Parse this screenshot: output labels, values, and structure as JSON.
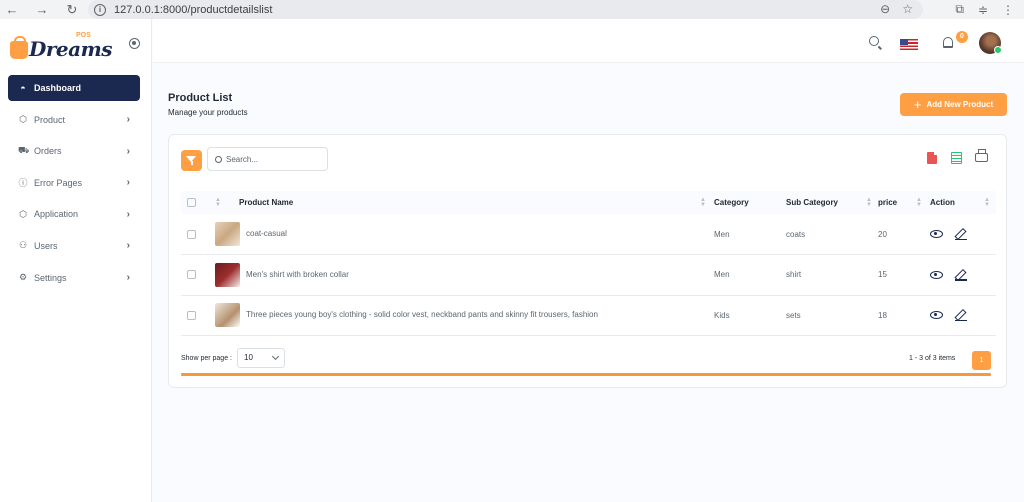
{
  "browser": {
    "url": "127.0.0.1:8000/productdetailslist",
    "back_icon": "arrow-left-icon",
    "forward_icon": "arrow-right-icon",
    "reload_icon": "reload-icon"
  },
  "brand": {
    "logo_text": "Dreams",
    "logo_sub": "POS",
    "accent_color": "#ff9f43",
    "primary_color": "#1b2850"
  },
  "sidebar": {
    "items": [
      {
        "label": "Dashboard",
        "icon": "dashboard-icon",
        "active": true
      },
      {
        "label": "Product",
        "icon": "box-icon"
      },
      {
        "label": "Orders",
        "icon": "cart-icon"
      },
      {
        "label": "Error Pages",
        "icon": "alert-circle-icon"
      },
      {
        "label": "Application",
        "icon": "cube-icon"
      },
      {
        "label": "Users",
        "icon": "user-icon"
      },
      {
        "label": "Settings",
        "icon": "gear-icon"
      }
    ]
  },
  "header": {
    "notification_count": "0"
  },
  "page": {
    "title": "Product List",
    "subtitle": "Manage your products",
    "add_button": "Add New Product"
  },
  "toolbar": {
    "search_placeholder": "Search..."
  },
  "table": {
    "columns": [
      "Product Name",
      "Category",
      "Sub Category",
      "price",
      "Action"
    ],
    "rows": [
      {
        "name": "coat-casual",
        "category": "Men",
        "sub_category": "coats",
        "price": "20"
      },
      {
        "name": "Men's shirt with broken collar",
        "category": "Men",
        "sub_category": "shirt",
        "price": "15"
      },
      {
        "name": "Three pieces young boy's clothing - solid color vest, neckband pants and skinny fit trousers, fashion",
        "category": "Kids",
        "sub_category": "sets",
        "price": "18"
      }
    ]
  },
  "footer": {
    "per_page_label": "Show per page :",
    "per_page_value": "10",
    "items_info": "1 - 3 of 3 items",
    "current_page": "1"
  }
}
